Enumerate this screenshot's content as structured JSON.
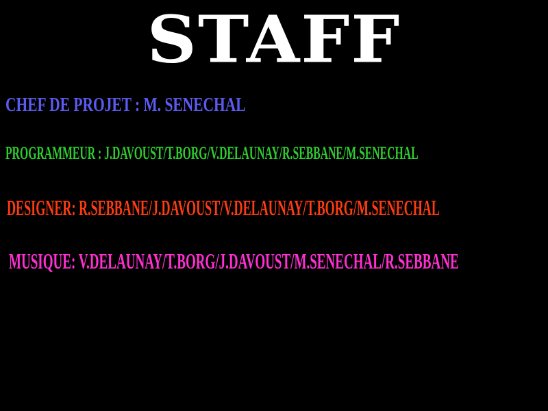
{
  "screen": {
    "title": "STAFF",
    "background_color": "#000000",
    "title_color": "#ffffff"
  },
  "credits": [
    {
      "text": "CHEF DE PROJET : M. SENECHAL",
      "color": "#5b5bf0"
    },
    {
      "text": "PROGRAMMEUR : J.DAVOUST/T.BORG/V.DELAUNAY/R.SEBBANE/M.SENECHAL",
      "color": "#2fcc2f"
    },
    {
      "text": "DESIGNER: R.SEBBANE/J.DAVOUST/V.DELAUNAY/T.BORG/M.SENECHAL",
      "color": "#ff3b10"
    },
    {
      "text": "MUSIQUE: V.DELAUNAY/T.BORG/J.DAVOUST/M.SENECHAL/R.SEBBANE",
      "color": "#ff2fd2"
    }
  ]
}
